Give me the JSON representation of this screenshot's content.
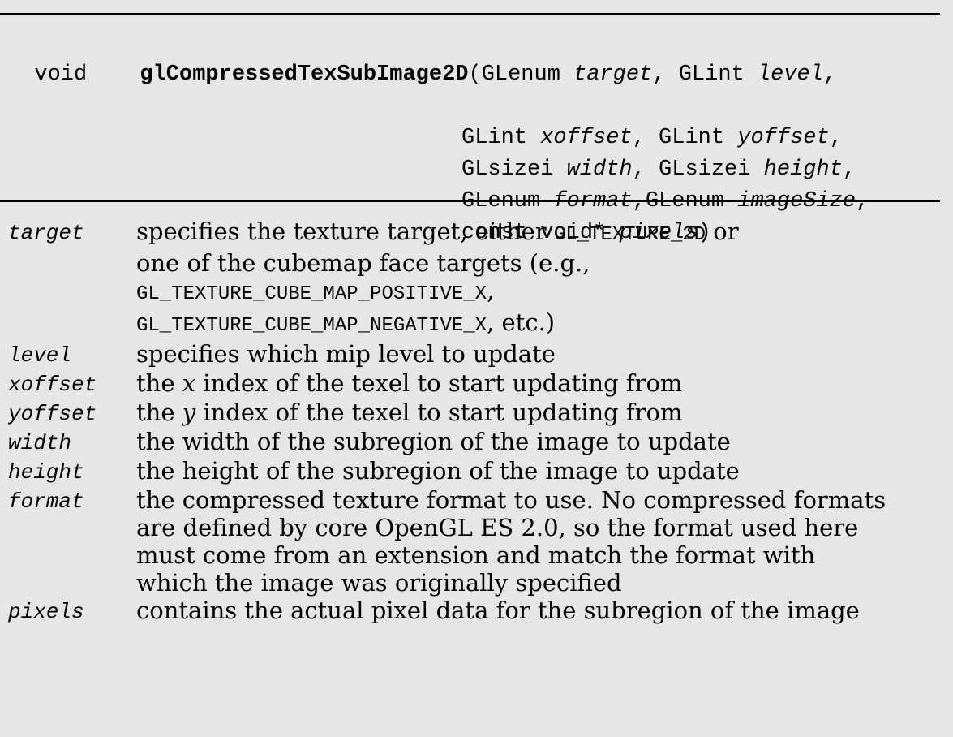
{
  "signature": {
    "return_type": "void",
    "function_name": "glCompressedTexSubImage2D",
    "open_paren": "(",
    "close_paren": ")",
    "lines": [
      [
        {
          "t": "GLenum ",
          "i": false
        },
        {
          "t": "target",
          "i": true
        },
        {
          "t": ", GLint ",
          "i": false
        },
        {
          "t": "level",
          "i": true
        },
        {
          "t": ",",
          "i": false
        }
      ],
      [
        {
          "t": "GLint ",
          "i": false
        },
        {
          "t": "xoffset",
          "i": true
        },
        {
          "t": ", GLint ",
          "i": false
        },
        {
          "t": "yoffset",
          "i": true
        },
        {
          "t": ",",
          "i": false
        }
      ],
      [
        {
          "t": "GLsizei ",
          "i": false
        },
        {
          "t": "width",
          "i": true
        },
        {
          "t": ", GLsizei ",
          "i": false
        },
        {
          "t": "height",
          "i": true
        },
        {
          "t": ",",
          "i": false
        }
      ],
      [
        {
          "t": "GLenum ",
          "i": false
        },
        {
          "t": "format",
          "i": true
        },
        {
          "t": ",GLenum ",
          "i": false
        },
        {
          "t": "imageSize",
          "i": true
        },
        {
          "t": ",",
          "i": false
        }
      ],
      [
        {
          "t": "const void* ",
          "i": false
        },
        {
          "t": "pixels",
          "i": true
        },
        {
          "t": ")",
          "i": false
        }
      ]
    ]
  },
  "parameters": [
    {
      "name": "target",
      "lines": [
        [
          {
            "t": "specifies the texture target, either "
          },
          {
            "t": "GL_TEXTURE_2D",
            "code": true
          },
          {
            "t": " or"
          }
        ],
        [
          {
            "t": "one of the cubemap face targets (e.g.,"
          }
        ],
        [
          {
            "t": "GL_TEXTURE_CUBE_MAP_POSITIVE_X",
            "code": true
          },
          {
            "t": ","
          }
        ],
        [
          {
            "t": "GL_TEXTURE_CUBE_MAP_NEGATIVE_X",
            "code": true
          },
          {
            "t": ", etc.)"
          }
        ]
      ]
    },
    {
      "name": "level",
      "lines": [
        [
          {
            "t": "specifies which mip level to update"
          }
        ]
      ]
    },
    {
      "name": "xoffset",
      "lines": [
        [
          {
            "t": "the "
          },
          {
            "t": "x",
            "italic": true
          },
          {
            "t": " index of the texel to start updating from"
          }
        ]
      ]
    },
    {
      "name": "yoffset",
      "lines": [
        [
          {
            "t": "the "
          },
          {
            "t": "y",
            "italic": true
          },
          {
            "t": " index of the texel to start updating from"
          }
        ]
      ]
    },
    {
      "name": "width",
      "lines": [
        [
          {
            "t": "the width of the subregion of the image to update"
          }
        ]
      ]
    },
    {
      "name": "height",
      "lines": [
        [
          {
            "t": "the height of the subregion of the image to update"
          }
        ]
      ]
    },
    {
      "name": "format",
      "lines": [
        [
          {
            "t": "the compressed texture format to use. No compressed formats"
          }
        ],
        [
          {
            "t": "are defined by core OpenGL ES 2.0, so the format used here"
          }
        ],
        [
          {
            "t": "must come from an extension and match the format with"
          }
        ],
        [
          {
            "t": "which the image was originally specified"
          }
        ]
      ]
    },
    {
      "name": "pixels",
      "lines": [
        [
          {
            "t": "contains the actual pixel data for the subregion of the image"
          }
        ]
      ]
    }
  ]
}
